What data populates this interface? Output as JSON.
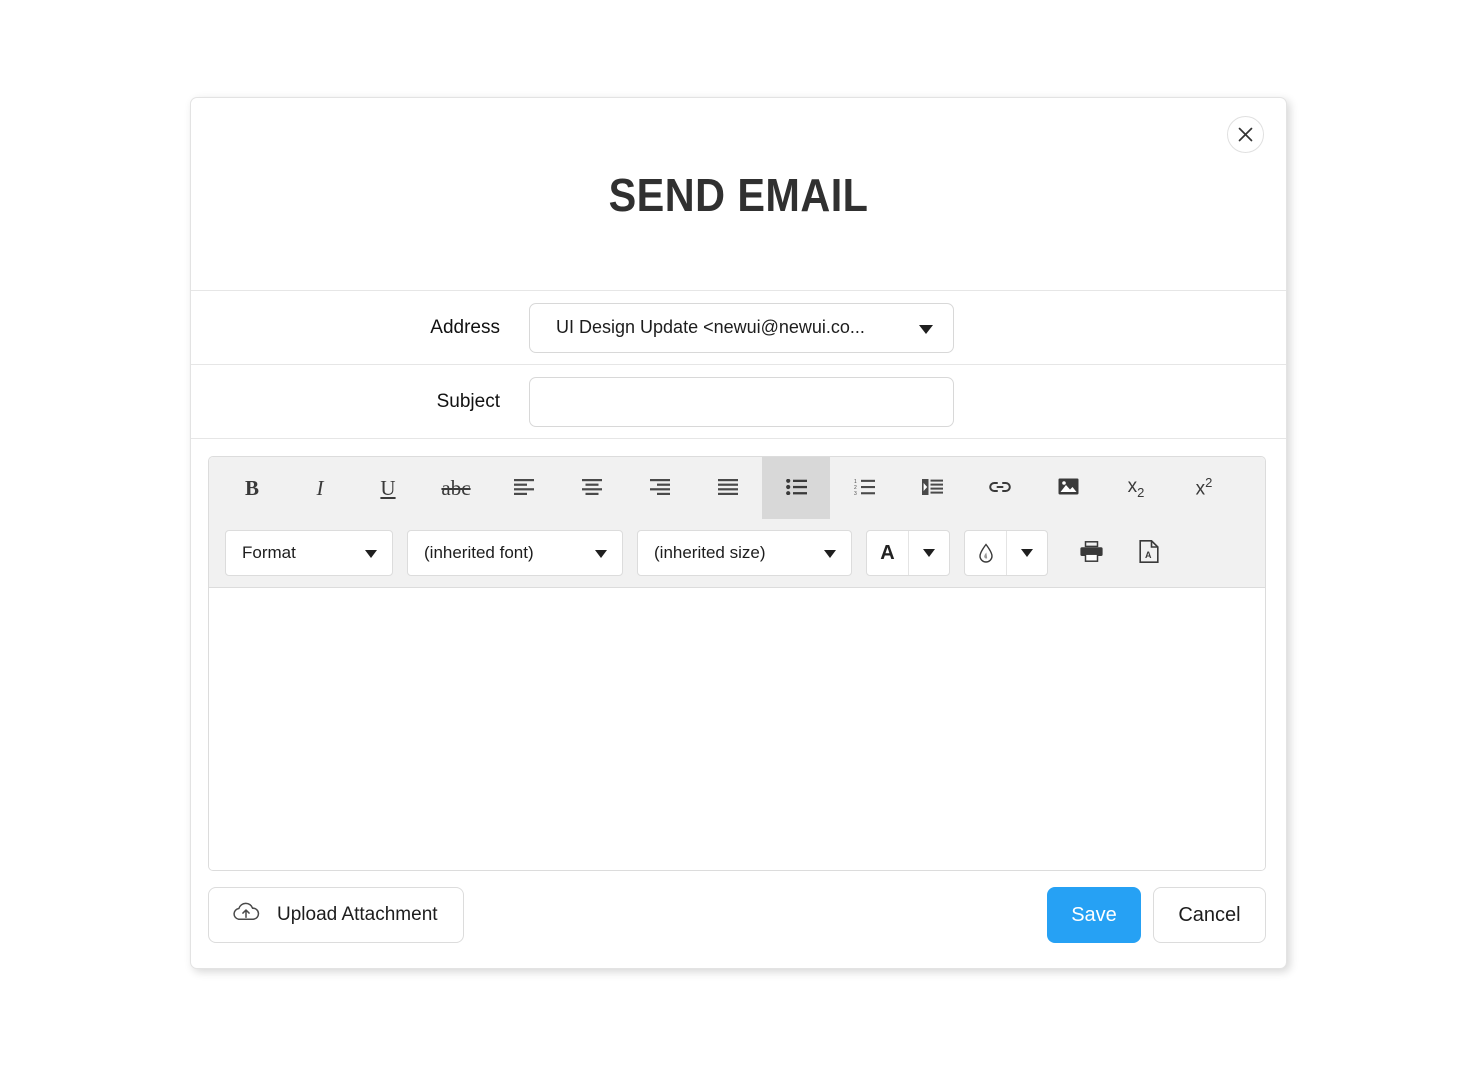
{
  "dialog": {
    "title": "SEND EMAIL",
    "close_icon": "close-icon"
  },
  "fields": {
    "address": {
      "label": "Address",
      "value": "UI Design Update <newui@newui.co...",
      "caret_icon": "chevron-down-icon"
    },
    "subject": {
      "label": "Subject",
      "value": "",
      "placeholder": ""
    }
  },
  "editor": {
    "toolbar_row1": [
      {
        "name": "bold-button",
        "icon": "bold-icon",
        "label": "B",
        "active": false
      },
      {
        "name": "italic-button",
        "icon": "italic-icon",
        "label": "I",
        "active": false
      },
      {
        "name": "underline-button",
        "icon": "underline-icon",
        "label": "U",
        "active": false
      },
      {
        "name": "strikethrough-button",
        "icon": "strikethrough-icon",
        "label": "abc",
        "active": false
      },
      {
        "name": "align-left-button",
        "icon": "align-left-icon",
        "label": "",
        "active": false
      },
      {
        "name": "align-center-button",
        "icon": "align-center-icon",
        "label": "",
        "active": false
      },
      {
        "name": "align-right-button",
        "icon": "align-right-icon",
        "label": "",
        "active": false
      },
      {
        "name": "align-justify-button",
        "icon": "align-justify-icon",
        "label": "",
        "active": false
      },
      {
        "name": "bullet-list-button",
        "icon": "bullet-list-icon",
        "label": "",
        "active": true
      },
      {
        "name": "numbered-list-button",
        "icon": "numbered-list-icon",
        "label": "",
        "active": false
      },
      {
        "name": "indent-button",
        "icon": "indent-icon",
        "label": "",
        "active": false
      },
      {
        "name": "link-button",
        "icon": "link-icon",
        "label": "",
        "active": false
      },
      {
        "name": "image-button",
        "icon": "image-icon",
        "label": "",
        "active": false
      },
      {
        "name": "subscript-button",
        "icon": "subscript-icon",
        "label": "x2",
        "active": false
      },
      {
        "name": "superscript-button",
        "icon": "superscript-icon",
        "label": "x2",
        "active": false
      }
    ],
    "format_dropdown": {
      "label": "Format",
      "caret_icon": "chevron-down-icon"
    },
    "font_dropdown": {
      "label": "(inherited font)",
      "caret_icon": "chevron-down-icon"
    },
    "size_dropdown": {
      "label": "(inherited size)",
      "caret_icon": "chevron-down-icon"
    },
    "text_color": {
      "label": "A",
      "icon": "text-color-icon",
      "caret_icon": "chevron-down-icon"
    },
    "background_color": {
      "label": "",
      "icon": "droplet-icon",
      "caret_icon": "chevron-down-icon"
    },
    "print_button": {
      "icon": "printer-icon"
    },
    "pdf_button": {
      "icon": "pdf-file-icon"
    },
    "content": ""
  },
  "footer": {
    "upload_label": "Upload Attachment",
    "upload_icon": "cloud-upload-icon",
    "save_label": "Save",
    "cancel_label": "Cancel"
  },
  "colors": {
    "accent": "#26a1f4",
    "toolbar_bg": "#f1f1f1",
    "toolbar_active": "#d8d8d8",
    "border": "#dcdcdc",
    "title": "#303030"
  }
}
